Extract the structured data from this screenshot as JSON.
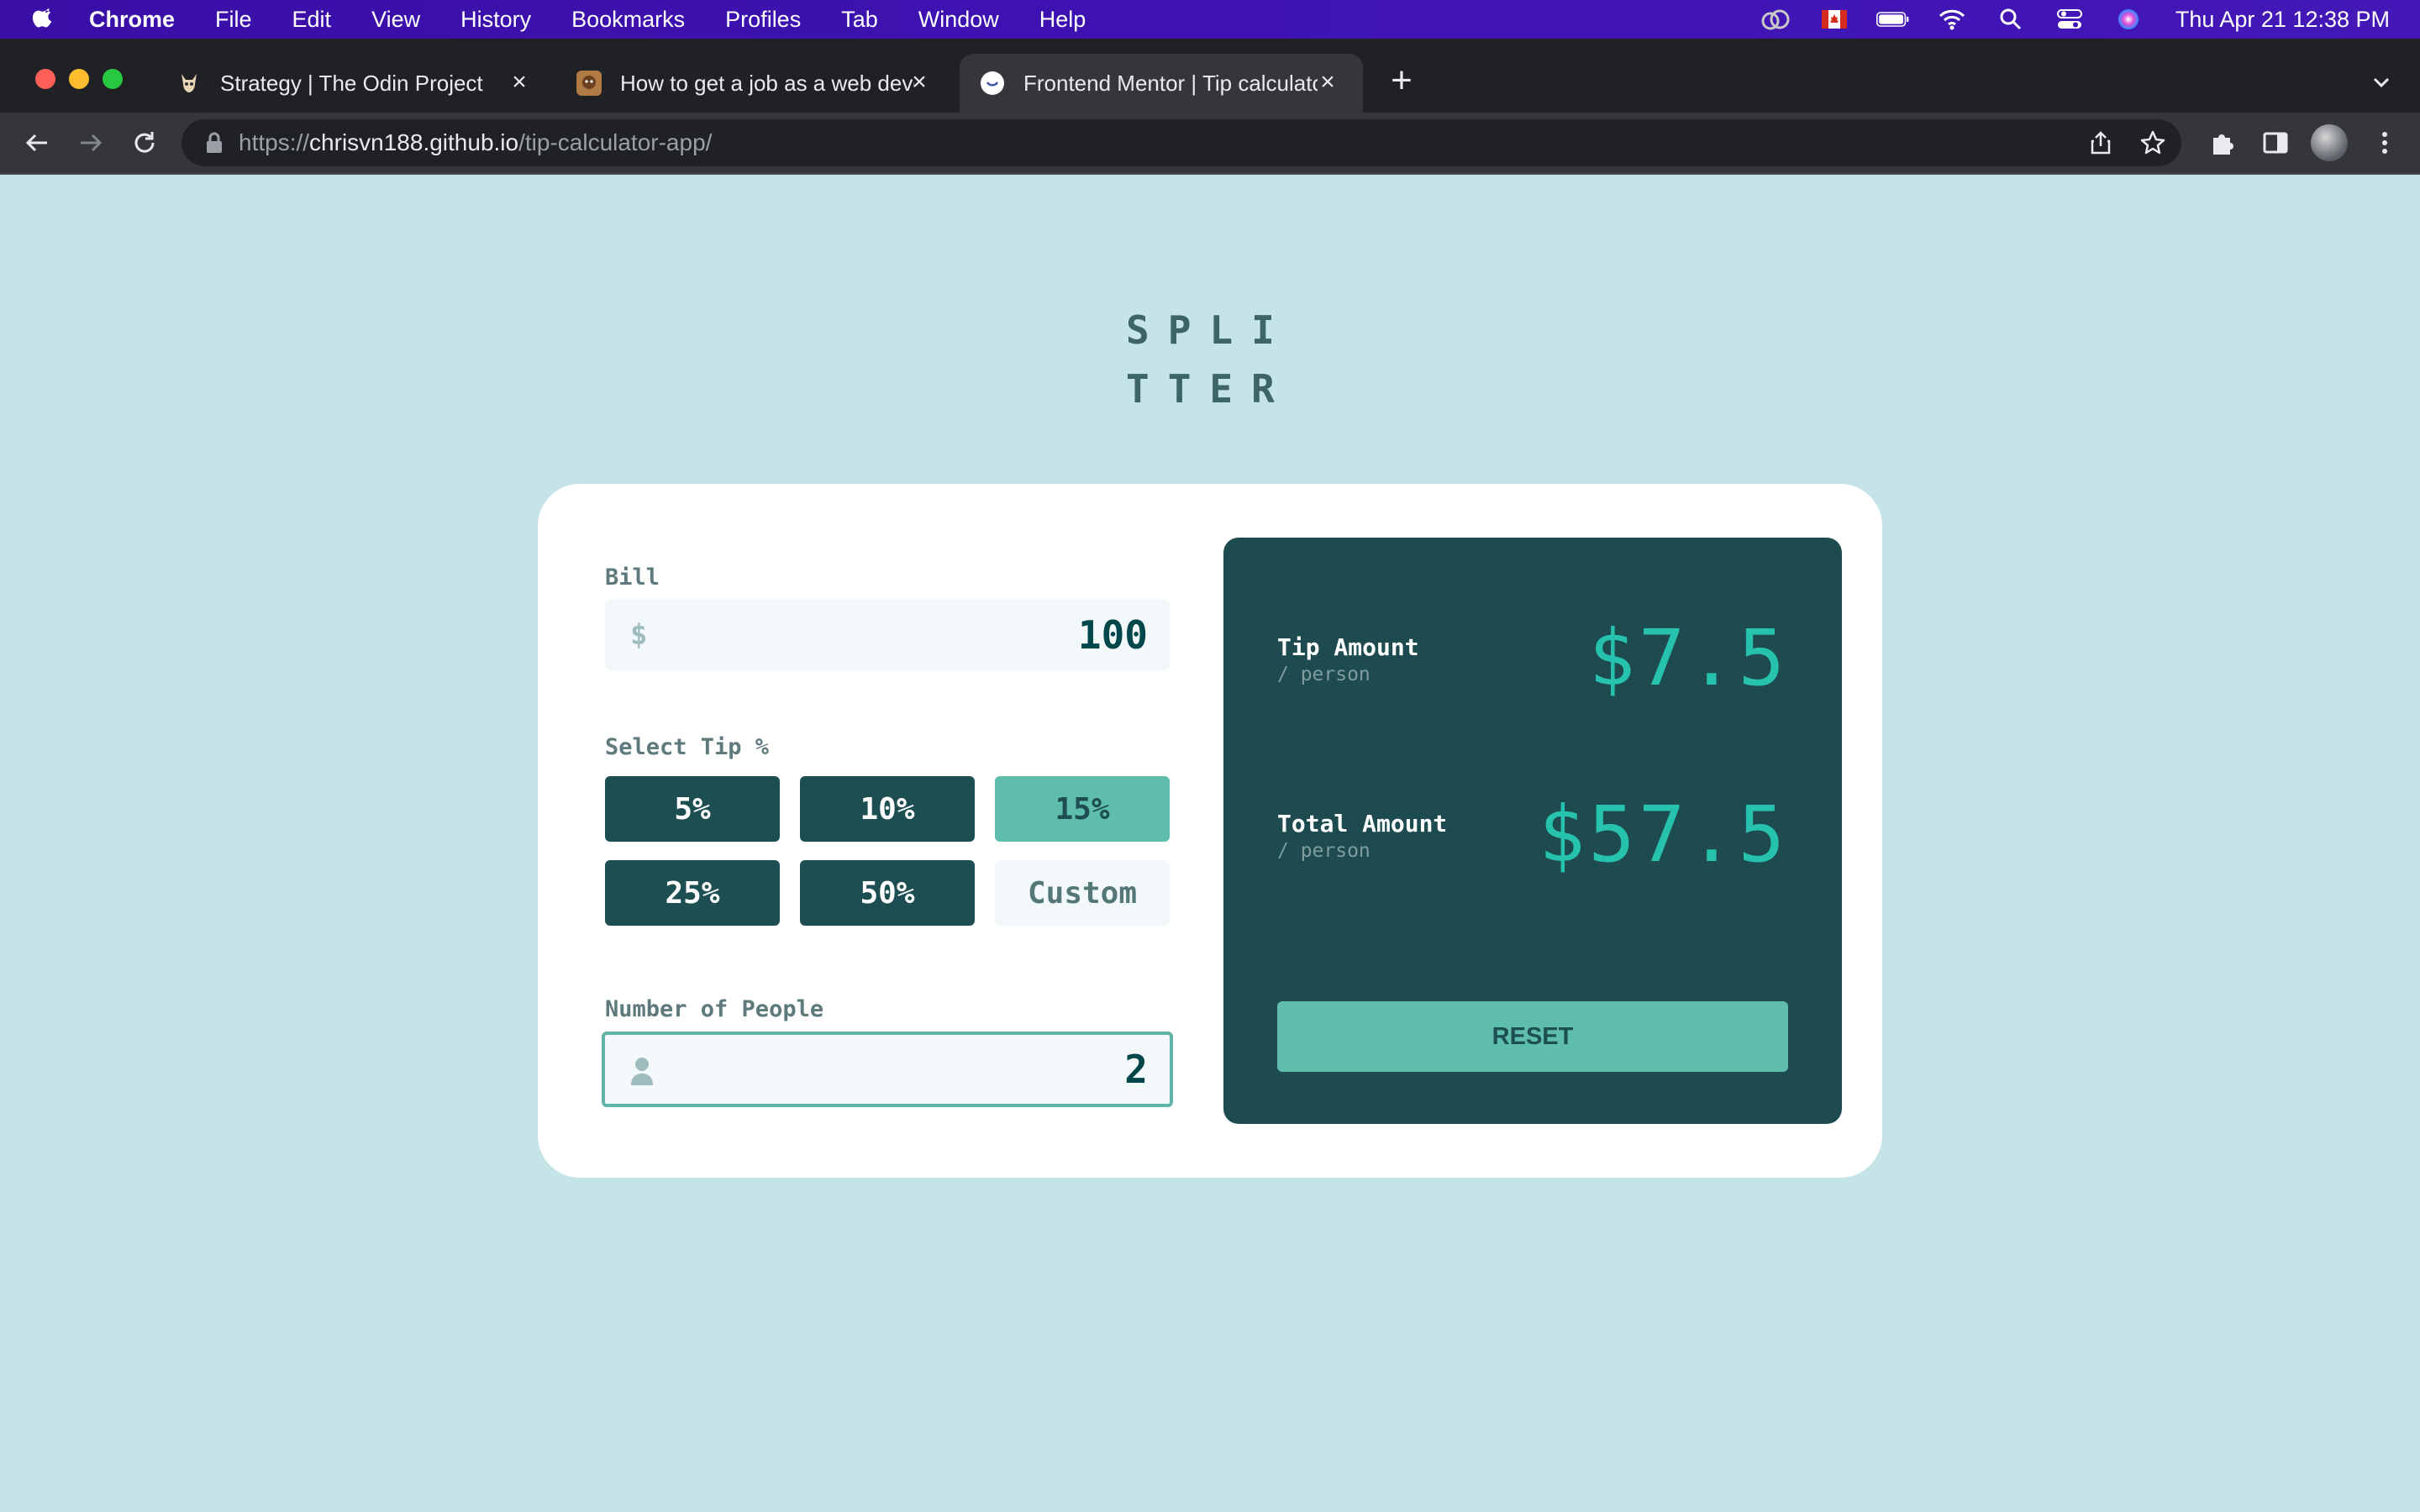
{
  "menubar": {
    "app_name": "Chrome",
    "menus": [
      "File",
      "Edit",
      "View",
      "History",
      "Bookmarks",
      "Profiles",
      "Tab",
      "Window",
      "Help"
    ],
    "clock": "Thu Apr 21  12:38 PM",
    "status_icons": [
      "creative-cloud-icon",
      "canada-flag-icon",
      "battery-icon",
      "wifi-icon",
      "spotlight-search-icon",
      "control-center-icon",
      "siri-icon"
    ]
  },
  "tabs": [
    {
      "title": "Strategy | The Odin Project",
      "active": false
    },
    {
      "title": "How to get a job as a web deve",
      "active": false
    },
    {
      "title": "Frontend Mentor | Tip calculato",
      "active": true
    }
  ],
  "toolbar": {
    "url_scheme": "https://",
    "url_host": "chrisvn188.github.io",
    "url_path": "/tip-calculator-app/"
  },
  "app": {
    "logo_line1": "SPLI",
    "logo_line2": "TTER",
    "bill_label": "Bill",
    "bill_currency": "$",
    "bill_value": "100",
    "tip_label": "Select Tip %",
    "tip_options": [
      {
        "label": "5%",
        "selected": false
      },
      {
        "label": "10%",
        "selected": false
      },
      {
        "label": "15%",
        "selected": true
      },
      {
        "label": "25%",
        "selected": false
      },
      {
        "label": "50%",
        "selected": false
      }
    ],
    "custom_placeholder": "Custom",
    "people_label": "Number of People",
    "people_value": "2",
    "tip_amount_label": "Tip Amount",
    "tip_amount_sub": "/ person",
    "tip_amount_value": "$7.5",
    "total_label": "Total Amount",
    "total_sub": "/ person",
    "total_value": "$57.5",
    "reset_label": "RESET"
  },
  "colors": {
    "page_bg": "#c5e4e7",
    "result_panel": "#1d4b4f",
    "accent": "#26c2ad",
    "selected_tip": "#5fbdac"
  }
}
